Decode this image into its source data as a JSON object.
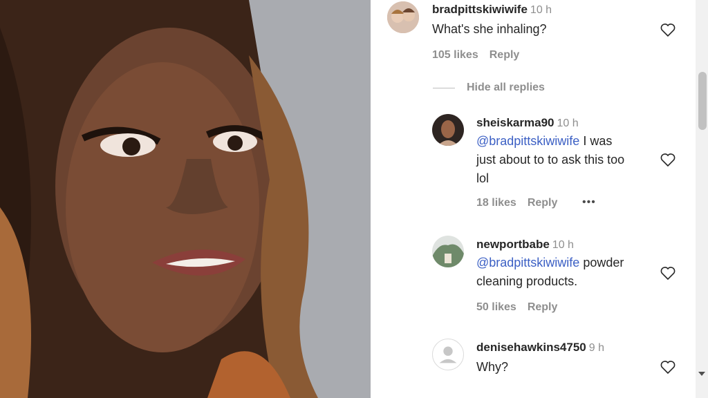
{
  "comments": [
    {
      "username": "bradpittskiwiwife",
      "time": "10 h",
      "mention": "",
      "text": "What's she inhaling?",
      "likes": "105 likes",
      "reply": "Reply"
    },
    {
      "username": "sheiskarma90",
      "time": "10 h",
      "mention": "@bradpittskiwiwife",
      "text_line1": " I was",
      "text_line2": "just about to to ask this too",
      "text_line3": "lol",
      "likes": "18 likes",
      "reply": "Reply",
      "more": "•••"
    },
    {
      "username": "newportbabe",
      "time": "10 h",
      "mention": "@bradpittskiwiwife",
      "text_line1": " powder",
      "text_line2": "cleaning products.",
      "likes": "50 likes",
      "reply": "Reply"
    },
    {
      "username": "denisehawkins4750",
      "time": "9 h",
      "text": "Why?"
    }
  ],
  "replies_toggle": "Hide all replies",
  "colors": {
    "text": "#262626",
    "meta": "#8e8e8e",
    "mention": "#3b5fc4"
  },
  "icons": [
    "heart-icon",
    "more-options-icon",
    "default-avatar-icon"
  ]
}
